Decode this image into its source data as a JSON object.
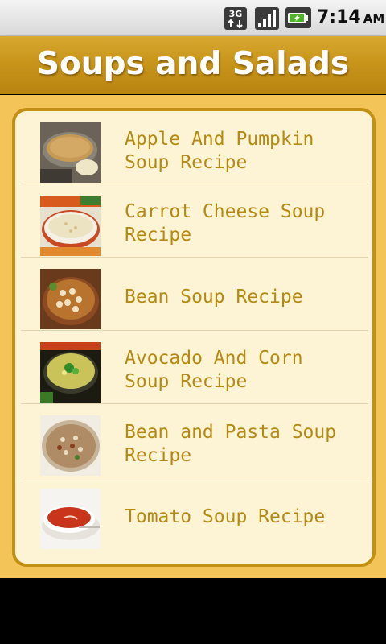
{
  "status_bar": {
    "network_icon": "3g-data-icon",
    "signal_icon": "signal-strength-icon",
    "battery_icon": "battery-charging-icon",
    "time": "7:14",
    "ampm": "AM"
  },
  "header": {
    "title": "Soups and Salads"
  },
  "recipes": [
    {
      "label": "Apple And Pumpkin Soup Recipe",
      "thumb_icon": "pumpkin-soup-thumbnail"
    },
    {
      "label": "Carrot Cheese Soup Recipe",
      "thumb_icon": "carrot-cheese-soup-thumbnail"
    },
    {
      "label": "Bean Soup Recipe",
      "thumb_icon": "bean-soup-thumbnail"
    },
    {
      "label": "Avocado And Corn Soup Recipe",
      "thumb_icon": "avocado-corn-soup-thumbnail"
    },
    {
      "label": "Bean and Pasta Soup Recipe",
      "thumb_icon": "bean-pasta-soup-thumbnail"
    },
    {
      "label": "Tomato Soup Recipe",
      "thumb_icon": "tomato-soup-thumbnail"
    }
  ],
  "colors": {
    "title_bar": "#c8951a",
    "background": "#f3c559",
    "panel": "#fdf4d6",
    "label_text": "#b58a12"
  }
}
